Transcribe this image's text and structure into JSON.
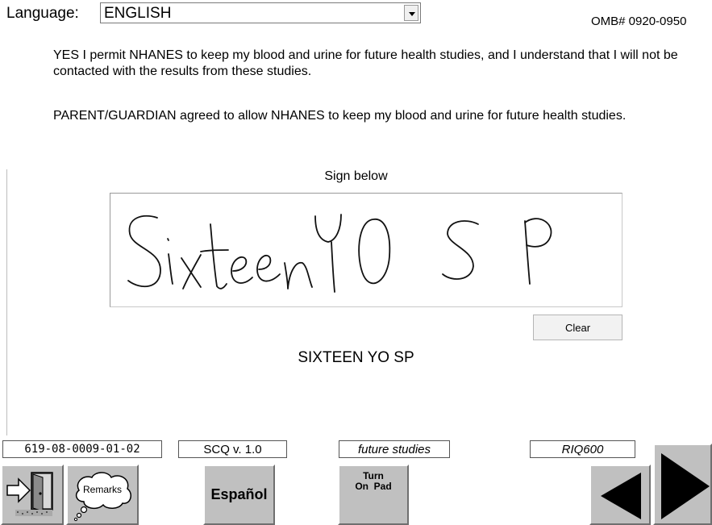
{
  "language": {
    "label": "Language:",
    "value": "ENGLISH"
  },
  "omb": "OMB# 0920-0950",
  "consent": {
    "yes_text": "YES I permit NHANES to keep my blood and urine for future health studies, and I understand that I will not be contacted with the results from these studies.",
    "parent_text": "PARENT/GUARDIAN agreed to allow NHANES to keep my blood and urine for future health studies."
  },
  "signature": {
    "prompt": "Sign below",
    "handwritten": "Sixteen YO SP",
    "clear_label": "Clear",
    "signer_name": "SIXTEEN YO SP"
  },
  "status": {
    "id": "619-08-0009-01-02",
    "version": "SCQ v. 1.0",
    "section": "future studies",
    "item": "RIQ600"
  },
  "buttons": {
    "exit_icon": "door-exit-icon",
    "remarks_label": "Remarks",
    "espanol_label": "Español",
    "pad_label_line1": "Turn",
    "pad_label_line2": "On  Pad",
    "prev_icon": "arrow-left-icon",
    "next_icon": "arrow-right-icon"
  }
}
